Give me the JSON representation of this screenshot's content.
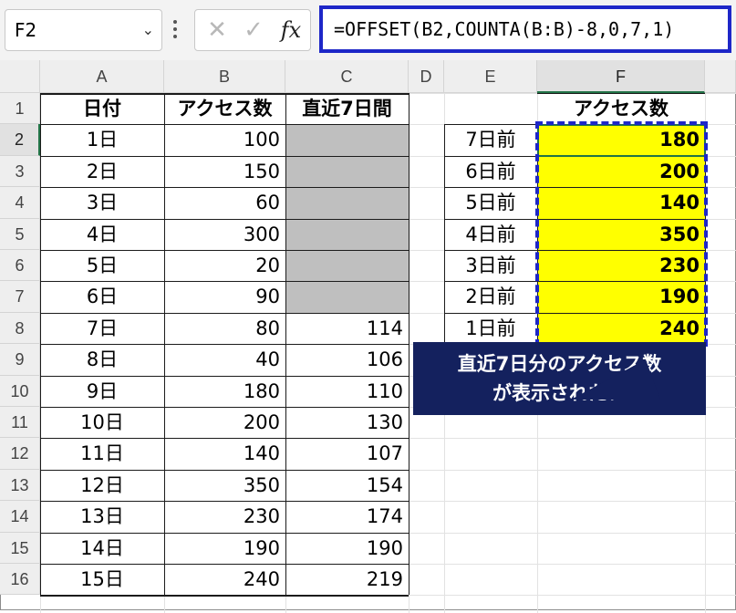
{
  "formula_bar": {
    "name_box": "F2",
    "cancel_icon": "✕",
    "enter_icon": "✓",
    "fx_label": "fx",
    "formula": "=OFFSET(B2,COUNTA(B:B)-8,0,7,1)"
  },
  "columns": [
    "A",
    "B",
    "C",
    "D",
    "E",
    "F"
  ],
  "rows": [
    "1",
    "2",
    "3",
    "4",
    "5",
    "6",
    "7",
    "8",
    "9",
    "10",
    "11",
    "12",
    "13",
    "14",
    "15",
    "16"
  ],
  "table_headers": {
    "date": "日付",
    "access": "アクセス数",
    "recent7": "直近7日間"
  },
  "data_rows": [
    {
      "date": "1日",
      "access": "100",
      "recent7": ""
    },
    {
      "date": "2日",
      "access": "150",
      "recent7": ""
    },
    {
      "date": "3日",
      "access": "60",
      "recent7": ""
    },
    {
      "date": "4日",
      "access": "300",
      "recent7": ""
    },
    {
      "date": "5日",
      "access": "20",
      "recent7": ""
    },
    {
      "date": "6日",
      "access": "90",
      "recent7": ""
    },
    {
      "date": "7日",
      "access": "80",
      "recent7": "114"
    },
    {
      "date": "8日",
      "access": "40",
      "recent7": "106"
    },
    {
      "date": "9日",
      "access": "180",
      "recent7": "110"
    },
    {
      "date": "10日",
      "access": "200",
      "recent7": "130"
    },
    {
      "date": "11日",
      "access": "140",
      "recent7": "107"
    },
    {
      "date": "12日",
      "access": "350",
      "recent7": "154"
    },
    {
      "date": "13日",
      "access": "230",
      "recent7": "174"
    },
    {
      "date": "14日",
      "access": "190",
      "recent7": "190"
    },
    {
      "date": "15日",
      "access": "240",
      "recent7": "219"
    }
  ],
  "side_table": {
    "header": "アクセス数",
    "rows": [
      {
        "label": "7日前",
        "value": "180"
      },
      {
        "label": "6日前",
        "value": "200"
      },
      {
        "label": "5日前",
        "value": "140"
      },
      {
        "label": "4日前",
        "value": "350"
      },
      {
        "label": "3日前",
        "value": "230"
      },
      {
        "label": "2日前",
        "value": "190"
      },
      {
        "label": "1日前",
        "value": "240"
      }
    ]
  },
  "callout": {
    "line1": "直近7日分のアクセス数",
    "line2": "が表示された！"
  },
  "colors": {
    "highlight": "#ffff00",
    "blank_fill": "#bfbfbf",
    "accent_blue": "#1e27c8",
    "callout_bg": "#14215e",
    "excel_green": "#217346"
  }
}
